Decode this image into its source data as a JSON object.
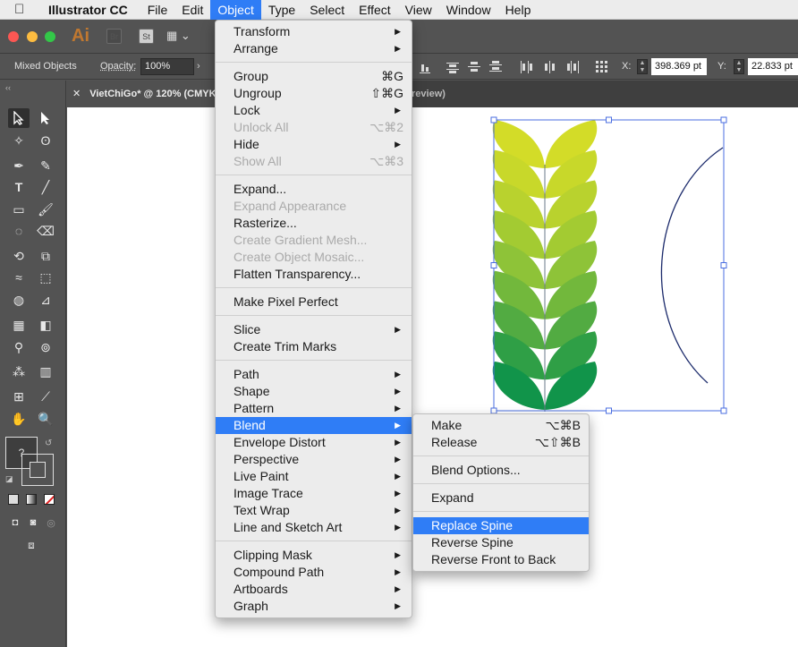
{
  "menubar": {
    "app_name": "Illustrator CC",
    "items": [
      "File",
      "Edit",
      "Object",
      "Type",
      "Select",
      "Effect",
      "View",
      "Window",
      "Help"
    ],
    "active": "Object"
  },
  "appbar": {
    "logo": "Ai",
    "bridge_label": "Br",
    "stock_label": "St"
  },
  "controlbar": {
    "selection_label": "Mixed Objects",
    "opacity_label": "Opacity:",
    "opacity_value": "100%",
    "x_label": "X:",
    "x_value": "398.369 pt",
    "y_label": "Y:",
    "y_value": "22.833 pt"
  },
  "document": {
    "tab_title": "VietChiGo* @ 120% (CMYK/",
    "preview_tag": "review)"
  },
  "object_menu": {
    "items": [
      {
        "label": "Transform",
        "submenu": true
      },
      {
        "label": "Arrange",
        "submenu": true
      },
      {
        "label": "Group",
        "shortcut": "⌘G"
      },
      {
        "label": "Ungroup",
        "shortcut": "⇧⌘G"
      },
      {
        "label": "Lock",
        "submenu": true
      },
      {
        "label": "Unlock All",
        "shortcut": "⌥⌘2",
        "disabled": true
      },
      {
        "label": "Hide",
        "submenu": true
      },
      {
        "label": "Show All",
        "shortcut": "⌥⌘3",
        "disabled": true
      },
      {
        "label": "Expand..."
      },
      {
        "label": "Expand Appearance",
        "disabled": true
      },
      {
        "label": "Rasterize..."
      },
      {
        "label": "Create Gradient Mesh...",
        "disabled": true
      },
      {
        "label": "Create Object Mosaic...",
        "disabled": true
      },
      {
        "label": "Flatten Transparency..."
      },
      {
        "label": "Make Pixel Perfect"
      },
      {
        "label": "Slice",
        "submenu": true
      },
      {
        "label": "Create Trim Marks"
      },
      {
        "label": "Path",
        "submenu": true
      },
      {
        "label": "Shape",
        "submenu": true
      },
      {
        "label": "Pattern",
        "submenu": true
      },
      {
        "label": "Blend",
        "submenu": true,
        "highlighted": true
      },
      {
        "label": "Envelope Distort",
        "submenu": true
      },
      {
        "label": "Perspective",
        "submenu": true
      },
      {
        "label": "Live Paint",
        "submenu": true
      },
      {
        "label": "Image Trace",
        "submenu": true
      },
      {
        "label": "Text Wrap",
        "submenu": true
      },
      {
        "label": "Line and Sketch Art",
        "submenu": true
      },
      {
        "label": "Clipping Mask",
        "submenu": true
      },
      {
        "label": "Compound Path",
        "submenu": true
      },
      {
        "label": "Artboards",
        "submenu": true
      },
      {
        "label": "Graph",
        "submenu": true
      }
    ]
  },
  "blend_menu": {
    "items": [
      {
        "label": "Make",
        "shortcut": "⌥⌘B"
      },
      {
        "label": "Release",
        "shortcut": "⌥⇧⌘B"
      },
      {
        "label": "Blend Options..."
      },
      {
        "label": "Expand"
      },
      {
        "label": "Replace Spine",
        "highlighted": true
      },
      {
        "label": "Reverse Spine"
      },
      {
        "label": "Reverse Front to Back"
      }
    ]
  },
  "artwork": {
    "leaf_colors": [
      "#d3dc28",
      "#c8d82a",
      "#b9d22e",
      "#a3cb32",
      "#8ec338",
      "#72b83c",
      "#52ab42",
      "#2f9f46",
      "#11944a"
    ],
    "selection_color": "#4a6ee0"
  }
}
